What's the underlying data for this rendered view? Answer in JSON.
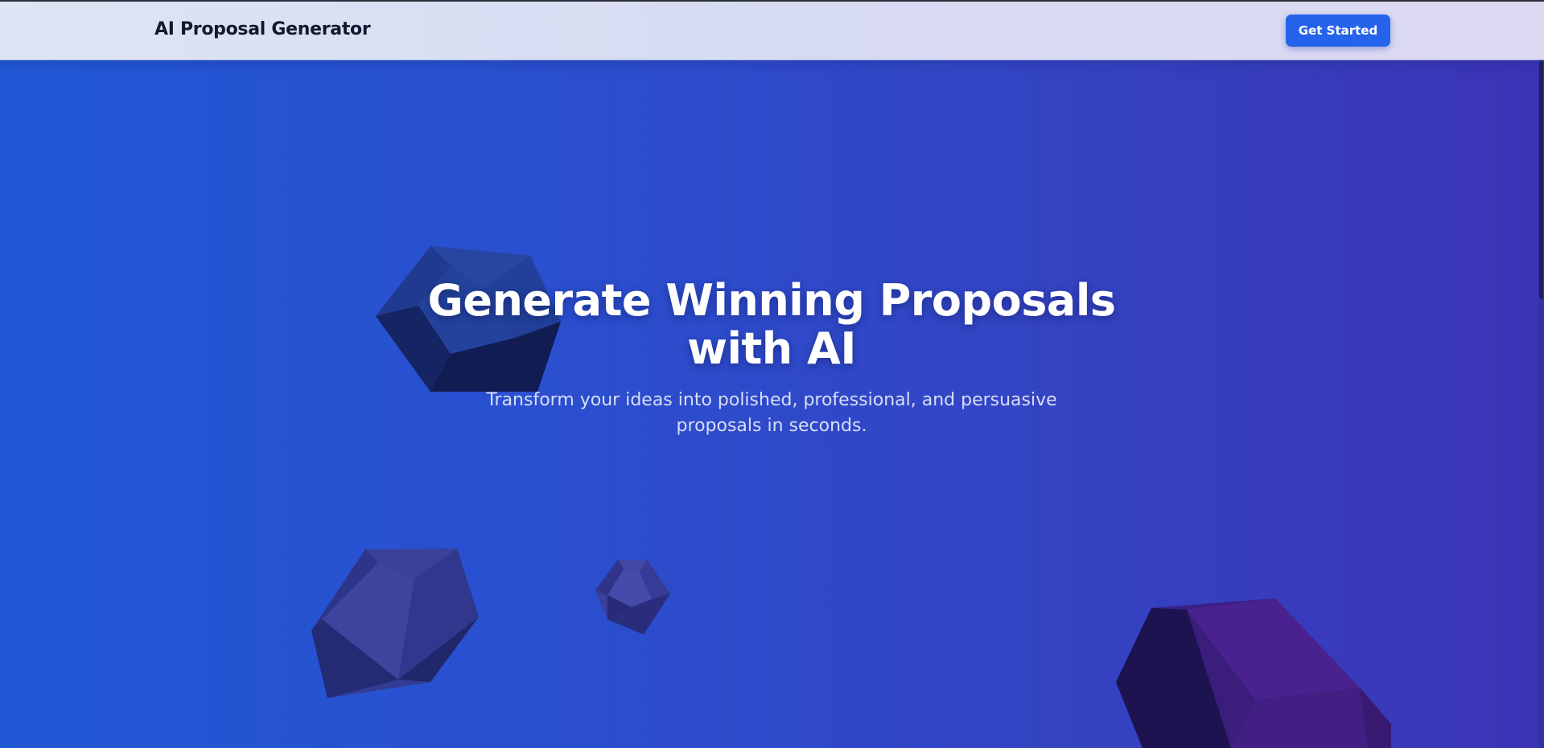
{
  "navbar": {
    "brand": "AI Proposal Generator",
    "cta_label": "Get Started"
  },
  "hero": {
    "title": "Generate Winning Proposals with AI",
    "subtitle": "Transform your ideas into polished, professional, and persuasive proposals in seconds."
  },
  "colors": {
    "gradient_start": "#2158d6",
    "gradient_end": "#3b34b5",
    "navbar_bg": "#dde5f4",
    "button": "#2563eb",
    "brand_text": "#111a2e"
  },
  "decorations": [
    "dark-blue-polyhedron",
    "indigo-polyhedron",
    "small-indigo-polyhedron",
    "purple-polyhedron"
  ]
}
